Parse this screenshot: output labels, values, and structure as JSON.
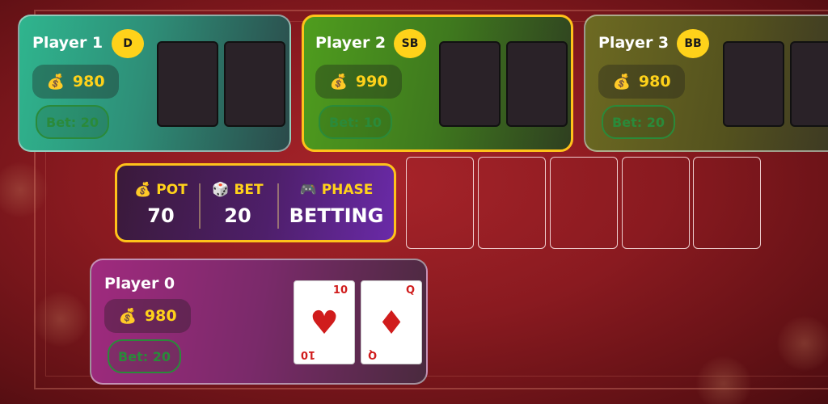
{
  "players": [
    {
      "id": "p1",
      "name": "Player 1",
      "role": "D",
      "chips": "980",
      "bet": "Bet: 20"
    },
    {
      "id": "p2",
      "name": "Player 2",
      "role": "SB",
      "chips": "990",
      "bet": "Bet: 10"
    },
    {
      "id": "p3",
      "name": "Player 3",
      "role": "BB",
      "chips": "980",
      "bet": "Bet: 20"
    },
    {
      "id": "p0",
      "name": "Player 0",
      "chips": "980",
      "bet": "Bet: 20",
      "hand": [
        {
          "rank": "10",
          "suit": "♥",
          "suit_name": "hearts"
        },
        {
          "rank": "Q",
          "suit": "♦",
          "suit_name": "diamonds"
        }
      ]
    }
  ],
  "table_info": {
    "pot_label": "POT",
    "pot_value": "70",
    "bet_label": "BET",
    "bet_value": "20",
    "phase_label": "PHASE",
    "phase_value": "BETTING"
  },
  "icons": {
    "chips": "💰",
    "pot": "💰",
    "bet": "🎲",
    "phase": "🎮"
  },
  "colors": {
    "accent": "#ffc21a",
    "chips_text": "#ffd21a",
    "bet_text": "#2a8a3a",
    "card_red": "#d01c1c"
  }
}
